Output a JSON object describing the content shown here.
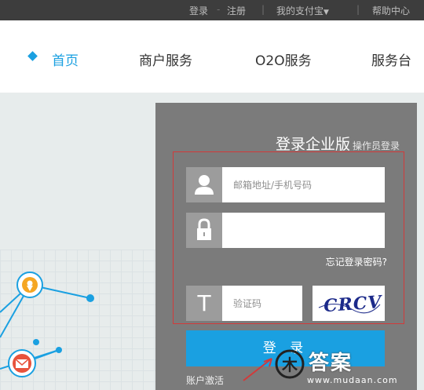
{
  "topbar": {
    "login": "登录",
    "register": "注册",
    "my_alipay": "我的支付宝",
    "help": "帮助中心"
  },
  "nav": {
    "items": [
      "首页",
      "商户服务",
      "O2O服务",
      "服务台"
    ]
  },
  "login_panel": {
    "title": "登录企业版",
    "subtitle": "操作员登录",
    "account_placeholder": "邮箱地址/手机号码",
    "forgot": "忘记登录密码?",
    "captcha_placeholder": "验证码",
    "captcha_text": "CRCV",
    "login_button": "登 录",
    "activate": "账户激活"
  },
  "watermark": {
    "brand": "答案",
    "url": "www.mudaan.com"
  },
  "colors": {
    "accent": "#1aa0e1",
    "panel": "#7b7b7b",
    "highlight_box": "#d23a3a",
    "marker_orange": "#f5a623",
    "marker_red": "#e8533d"
  }
}
